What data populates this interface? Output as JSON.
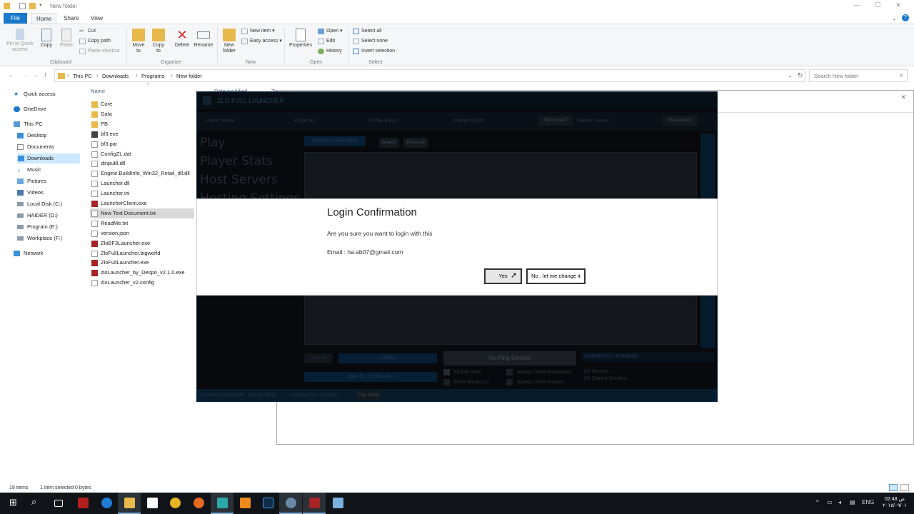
{
  "window": {
    "title": "New folder",
    "minimize": "—",
    "maximize": "☐",
    "close": "✕"
  },
  "ribbon_tabs": {
    "file": "File",
    "home": "Home",
    "share": "Share",
    "view": "View"
  },
  "ribbon": {
    "clipboard": {
      "pin": "Pin to Quick access",
      "copy": "Copy",
      "paste": "Paste",
      "cut": "Cut",
      "copy_path": "Copy path",
      "paste_shortcut": "Paste shortcut",
      "group": "Clipboard"
    },
    "organize": {
      "move_to": "Move to",
      "copy_to": "Copy to",
      "delete": "Delete",
      "rename": "Rename",
      "group": "Organize"
    },
    "new": {
      "new_folder": "New folder",
      "new_item": "New item",
      "easy_access": "Easy access",
      "group": "New"
    },
    "open": {
      "properties": "Properties",
      "open": "Open",
      "edit": "Edit",
      "history": "History",
      "group": "Open"
    },
    "select": {
      "select_all": "Select all",
      "select_none": "Select none",
      "invert": "Invert selection",
      "group": "Select"
    }
  },
  "address": {
    "crumbs": [
      "This PC",
      "Downloads",
      "Programs",
      "New folder"
    ],
    "search_placeholder": "Search New folder"
  },
  "nav": {
    "quick_access": "Quick access",
    "onedrive": "OneDrive",
    "this_pc": "This PC",
    "desktop": "Desktop",
    "documents": "Documents",
    "downloads": "Downloads",
    "music": "Music",
    "pictures": "Pictures",
    "videos": "Videos",
    "local_disk": "Local Disk (C:)",
    "haider": "HAIDER (D:)",
    "program": "Program (E:)",
    "workplace": "Workplace (F:)",
    "network": "Network"
  },
  "filelist": {
    "col_name": "Name",
    "col_date": "Date modified",
    "col_type": "Ty",
    "files": [
      {
        "name": "Core",
        "kind": "folder"
      },
      {
        "name": "Data",
        "kind": "folder"
      },
      {
        "name": "PB",
        "kind": "folder"
      },
      {
        "name": "bf3.exe",
        "kind": "exe"
      },
      {
        "name": "bf3.par",
        "kind": "file"
      },
      {
        "name": "ConfigZL.dat",
        "kind": "file"
      },
      {
        "name": "dinput8.dll",
        "kind": "file"
      },
      {
        "name": "Engine.BuildInfo_Win32_Retail_dll.dll",
        "kind": "file"
      },
      {
        "name": "Launcher.dll",
        "kind": "file"
      },
      {
        "name": "Launcher.ini",
        "kind": "file"
      },
      {
        "name": "LauncherClient.exe",
        "kind": "zlo"
      },
      {
        "name": "New Text Document.txt",
        "kind": "file"
      },
      {
        "name": "ReadMe.txt",
        "kind": "file"
      },
      {
        "name": "version.json",
        "kind": "file"
      },
      {
        "name": "ZloBF3Launcher.exe",
        "kind": "zlo"
      },
      {
        "name": "ZloFullLauncher.bigworld",
        "kind": "file"
      },
      {
        "name": "ZloFullLauncher.exe",
        "kind": "zlo"
      },
      {
        "name": "zloLauncher_by_Despo_v2.1.0.exe",
        "kind": "zlo"
      },
      {
        "name": "zloLauncher_v2.config",
        "kind": "file"
      }
    ]
  },
  "launcher": {
    "title": "ZLO FULL LAUNCHER",
    "player_name": "Player Name :",
    "player_id": "Player ID :",
    "profile_status": "Profile Status :",
    "master_client": "Master Client :",
    "master_server": "Master Server :",
    "reconnect": "Reconnect",
    "menu_play": "Play",
    "menu_stats": "Player Stats",
    "menu_host": "Host Servers",
    "menu_hosting": "Hosting Settings",
    "search_servers": "SEARCH SERVERS",
    "search": "Search",
    "reset_all": "Reset all",
    "type_id": "Type ID",
    "check": "Check",
    "join_id": "Join ID : [ Unknown ]",
    "reping": "Re-Ping Servers",
    "currently_running": "CURRENTLY RUNNING",
    "simple_view": "Simple View",
    "show_black_list": "Show Black List",
    "always_fav": "Always Show Favourites",
    "always_hosted": "Always Show Hosted",
    "servers": "(0) Servers",
    "owned_servers": "(0) Owned Servers",
    "game_state": "Current Game State : Not Running",
    "loading": "Loading the Launcher ...",
    "tray_mode": "Tray Mode"
  },
  "dialog": {
    "title": "Login Confirmation",
    "message": "Are you sure you want to login with this",
    "email": "Email : ha.ab07@gmail.com",
    "yes": "Yes",
    "no": "No , let me change it"
  },
  "status": {
    "items": "19 items",
    "selected": "1 item selected  0 bytes"
  },
  "taskbar": {
    "lang": "ENG",
    "time": "02:48 ص",
    "date": "٢٠١٥/٠٩/٠١"
  }
}
